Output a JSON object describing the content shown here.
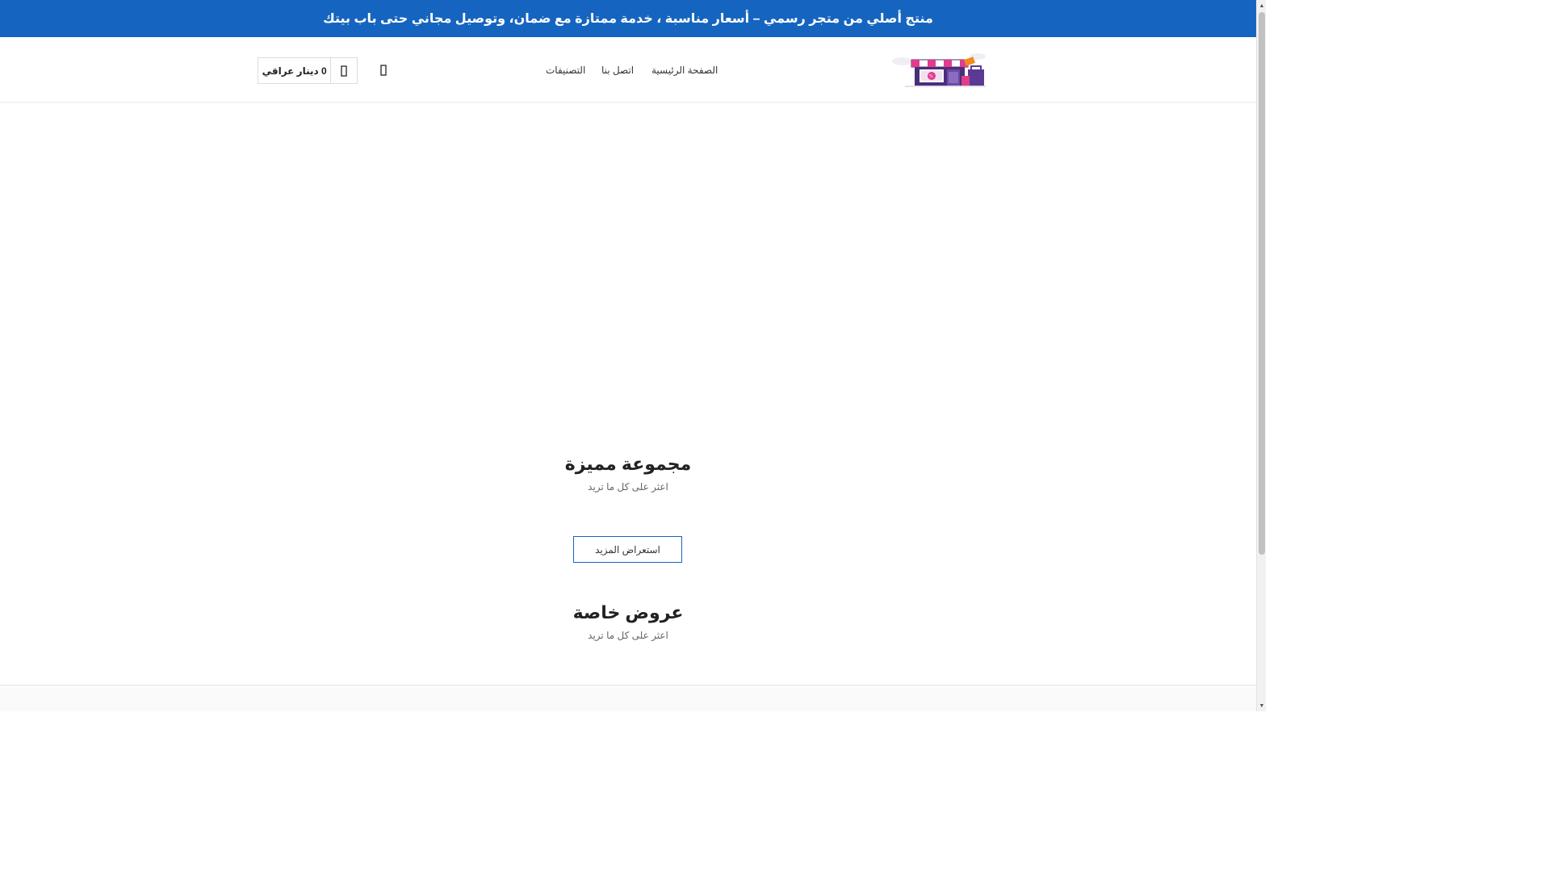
{
  "announcement": {
    "text": "منتج أصلي من متجر رسمي – أسعار مناسبة ، خدمة ممتازة مع ضمان، وتوصيل مجاني حتى باب بيتك"
  },
  "header": {
    "logo_icon": "storefront-logo",
    "nav": {
      "home": "الصفحة الرئيسية",
      "contact": "اتصل بنا",
      "categories": "التصنيفات"
    },
    "cart": {
      "amount": "0 دينار عراقي",
      "icon": "shopping-bag-icon"
    },
    "search_icon": "search-icon"
  },
  "featured": {
    "title": "مجموعة مميزة",
    "subtitle": "اعثر على كل ما تريد",
    "more_button": "استعراض المزيد"
  },
  "special_offers": {
    "title": "عروض خاصة",
    "subtitle": "اعثر على كل ما تريد"
  },
  "colors": {
    "brand_blue": "#1565c0",
    "text_dark": "#222222",
    "text_muted": "#666666"
  }
}
